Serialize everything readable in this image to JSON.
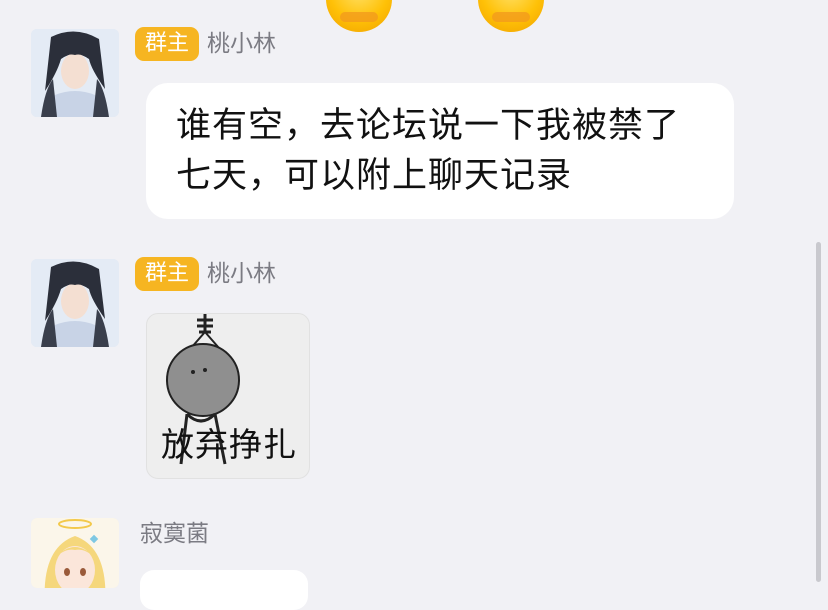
{
  "icons": {
    "top_emoji": "grinning-emoji-icon"
  },
  "messages": [
    {
      "badge": "群主",
      "sender": "桃小林",
      "text_lines": [
        "谁有空，去论坛说一下我被禁了",
        "七天，可以附上聊天记录"
      ]
    },
    {
      "badge": "群主",
      "sender": "桃小林",
      "sticker_caption": "放弃挣扎"
    },
    {
      "sender": "寂寞菌"
    }
  ],
  "colors": {
    "background": "#f1f1f5",
    "badge": "#f6b521",
    "bubble": "#ffffff"
  }
}
